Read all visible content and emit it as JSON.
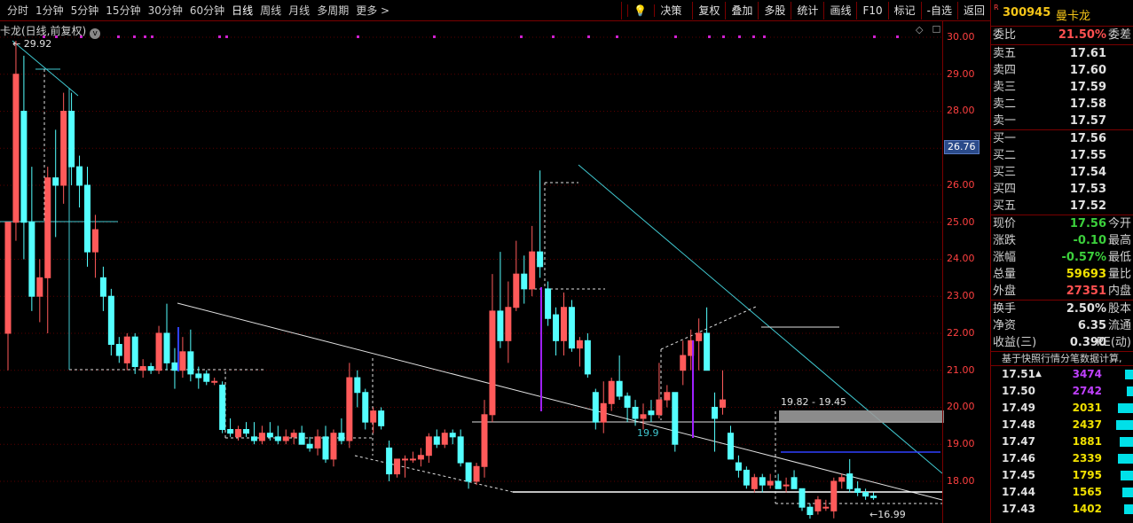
{
  "toolbar": {
    "periods": [
      "分时",
      "1分钟",
      "5分钟",
      "15分钟",
      "30分钟",
      "60分钟",
      "日线",
      "周线",
      "月线",
      "多周期",
      "更多 >"
    ],
    "active_period": "日线",
    "tools": [
      "决策",
      "复权",
      "叠加",
      "多股",
      "统计",
      "画线",
      "F10",
      "标记",
      "-自选",
      "返回"
    ]
  },
  "chart": {
    "title": "卡龙(日线,前复权)",
    "title_circle": "v",
    "high_label": "29.92",
    "low_label": "16.99",
    "range_label": "19.82 - 19.45",
    "support_label": "19.9",
    "crosshair_price": "26.76",
    "y_ticks": [
      "30.00",
      "29.00",
      "28.00",
      "27.00",
      "26.00",
      "25.00",
      "24.00",
      "23.00",
      "22.00",
      "21.00",
      "20.00",
      "19.00",
      "18.00"
    ],
    "controls": [
      "◇",
      "☐"
    ]
  },
  "chart_data": {
    "type": "candlestick",
    "ylim": [
      17.0,
      30.0
    ],
    "ohlc": [
      [
        22.0,
        25.0,
        21.0,
        25.0
      ],
      [
        25.0,
        29.9,
        24.5,
        29.0
      ],
      [
        28.0,
        29.5,
        24.0,
        25.0
      ],
      [
        25.0,
        26.5,
        22.6,
        23.0
      ],
      [
        23.0,
        24.0,
        22.3,
        23.5
      ],
      [
        23.5,
        26.5,
        22.0,
        26.2
      ],
      [
        26.2,
        27.5,
        24.6,
        26.0
      ],
      [
        26.0,
        28.5,
        25.5,
        28.0
      ],
      [
        28.0,
        28.5,
        26.0,
        26.5
      ],
      [
        26.5,
        26.8,
        25.4,
        26.0
      ],
      [
        26.0,
        26.5,
        23.8,
        24.2
      ],
      [
        24.2,
        25.2,
        23.5,
        24.8
      ],
      [
        23.5,
        23.8,
        22.6,
        23.0
      ],
      [
        23.0,
        23.2,
        21.4,
        21.7
      ],
      [
        21.7,
        21.9,
        21.2,
        21.4
      ],
      [
        21.2,
        22.0,
        21.0,
        21.9
      ],
      [
        21.9,
        22.0,
        20.9,
        21.1
      ],
      [
        21.0,
        21.3,
        20.8,
        21.1
      ],
      [
        21.1,
        21.2,
        20.9,
        21.0
      ],
      [
        21.0,
        22.2,
        20.9,
        22.0
      ],
      [
        22.0,
        22.8,
        21.0,
        21.2
      ],
      [
        21.2,
        21.6,
        20.5,
        21.0
      ],
      [
        21.0,
        21.9,
        20.8,
        21.5
      ],
      [
        21.5,
        22.1,
        20.7,
        20.9
      ],
      [
        20.9,
        21.1,
        20.5,
        20.8
      ],
      [
        20.9,
        21.0,
        20.6,
        20.7
      ],
      [
        20.7,
        20.8,
        20.6,
        20.7
      ],
      [
        20.6,
        20.7,
        19.3,
        19.4
      ],
      [
        19.4,
        19.7,
        19.2,
        19.3
      ],
      [
        19.2,
        19.5,
        19.1,
        19.4
      ],
      [
        19.4,
        19.6,
        19.2,
        19.3
      ],
      [
        19.2,
        19.6,
        19.0,
        19.1
      ],
      [
        19.1,
        19.5,
        19.0,
        19.3
      ],
      [
        19.3,
        19.6,
        19.1,
        19.2
      ],
      [
        19.2,
        19.5,
        19.0,
        19.1
      ],
      [
        19.1,
        19.4,
        19.0,
        19.2
      ],
      [
        19.2,
        19.4,
        19.0,
        19.3
      ],
      [
        19.3,
        19.5,
        19.0,
        19.0
      ],
      [
        19.0,
        19.2,
        18.8,
        18.9
      ],
      [
        18.9,
        19.4,
        18.7,
        19.2
      ],
      [
        19.2,
        19.5,
        18.5,
        18.6
      ],
      [
        18.6,
        19.4,
        18.4,
        19.3
      ],
      [
        19.3,
        19.7,
        19.0,
        19.1
      ],
      [
        19.1,
        21.2,
        18.9,
        20.8
      ],
      [
        20.8,
        21.0,
        20.0,
        20.4
      ],
      [
        20.4,
        20.5,
        19.4,
        19.6
      ],
      [
        19.6,
        20.0,
        19.3,
        19.9
      ],
      [
        19.9,
        20.0,
        19.4,
        19.5
      ],
      [
        18.9,
        19.1,
        18.0,
        18.2
      ],
      [
        18.2,
        18.6,
        18.1,
        18.6
      ],
      [
        18.6,
        18.7,
        18.1,
        18.6
      ],
      [
        18.6,
        18.8,
        18.5,
        18.6
      ],
      [
        18.6,
        18.9,
        18.4,
        18.7
      ],
      [
        18.7,
        19.3,
        18.5,
        19.2
      ],
      [
        19.2,
        19.4,
        18.9,
        19.0
      ],
      [
        19.0,
        19.4,
        18.9,
        19.3
      ],
      [
        19.3,
        19.4,
        19.0,
        19.2
      ],
      [
        19.2,
        19.4,
        18.4,
        18.5
      ],
      [
        18.5,
        18.5,
        17.8,
        18.0
      ],
      [
        18.0,
        18.5,
        17.9,
        18.4
      ],
      [
        18.4,
        20.2,
        18.1,
        19.8
      ],
      [
        19.8,
        23.6,
        19.6,
        22.6
      ],
      [
        22.6,
        24.2,
        21.6,
        21.8
      ],
      [
        21.8,
        23.4,
        21.2,
        22.7
      ],
      [
        22.7,
        24.5,
        22.6,
        23.6
      ],
      [
        23.6,
        24.1,
        22.8,
        23.2
      ],
      [
        23.2,
        24.9,
        23.0,
        24.2
      ],
      [
        24.2,
        26.4,
        23.5,
        23.8
      ],
      [
        23.2,
        23.4,
        22.2,
        22.4
      ],
      [
        22.5,
        22.7,
        21.4,
        21.8
      ],
      [
        21.8,
        23.1,
        21.4,
        22.7
      ],
      [
        22.7,
        22.9,
        21.5,
        21.6
      ],
      [
        21.6,
        21.9,
        21.1,
        21.8
      ],
      [
        21.8,
        22.0,
        20.8,
        20.9
      ],
      [
        20.4,
        20.5,
        19.4,
        19.6
      ],
      [
        19.6,
        20.7,
        19.3,
        20.1
      ],
      [
        20.1,
        20.8,
        19.9,
        20.7
      ],
      [
        20.7,
        21.4,
        20.2,
        20.3
      ],
      [
        20.3,
        20.4,
        19.6,
        20.0
      ],
      [
        20.0,
        20.2,
        19.5,
        19.7
      ],
      [
        19.7,
        20.1,
        19.4,
        19.8
      ],
      [
        19.9,
        20.2,
        19.6,
        19.8
      ],
      [
        19.8,
        21.2,
        19.7,
        20.2
      ],
      [
        20.2,
        20.6,
        20.0,
        20.4
      ],
      [
        20.4,
        20.4,
        18.8,
        19.0
      ],
      [
        21.0,
        21.8,
        20.6,
        21.4
      ],
      [
        21.4,
        22.1,
        21.0,
        21.8
      ],
      [
        21.8,
        22.4,
        21.0,
        22.0
      ],
      [
        22.0,
        22.7,
        21.0,
        21.0
      ],
      [
        20.0,
        20.4,
        18.8,
        19.7
      ],
      [
        20.0,
        21.0,
        19.8,
        20.2
      ],
      [
        19.3,
        19.5,
        18.6,
        18.6
      ],
      [
        18.5,
        18.7,
        18.1,
        18.3
      ],
      [
        18.3,
        18.4,
        17.8,
        17.9
      ],
      [
        17.8,
        18.2,
        17.7,
        18.1
      ],
      [
        18.1,
        18.2,
        17.7,
        17.9
      ],
      [
        17.9,
        18.2,
        17.8,
        18.0
      ],
      [
        18.0,
        18.2,
        17.8,
        17.8
      ],
      [
        17.9,
        18.1,
        17.7,
        17.9
      ],
      [
        18.1,
        18.3,
        17.8,
        17.8
      ],
      [
        17.8,
        17.8,
        17.2,
        17.3
      ],
      [
        17.3,
        17.4,
        16.99,
        17.1
      ],
      [
        17.2,
        17.6,
        17.1,
        17.5
      ],
      [
        17.3,
        17.5,
        17.2,
        17.3
      ],
      [
        17.2,
        18.1,
        17.0,
        18.0
      ],
      [
        18.0,
        18.2,
        17.8,
        18.1
      ],
      [
        18.2,
        18.6,
        17.7,
        17.8
      ],
      [
        17.8,
        18.0,
        17.6,
        17.7
      ],
      [
        17.7,
        17.8,
        17.5,
        17.6
      ],
      [
        17.6,
        17.7,
        17.5,
        17.56
      ]
    ]
  },
  "stock": {
    "code": "300945",
    "name": "曼卡龙",
    "r_mark": "R"
  },
  "quote": {
    "weibi": {
      "label": "委比",
      "value": "21.50%",
      "label2": "委差"
    },
    "sells": [
      {
        "label": "卖五",
        "price": "17.61"
      },
      {
        "label": "卖四",
        "price": "17.60"
      },
      {
        "label": "卖三",
        "price": "17.59"
      },
      {
        "label": "卖二",
        "price": "17.58"
      },
      {
        "label": "卖一",
        "price": "17.57"
      }
    ],
    "buys": [
      {
        "label": "买一",
        "price": "17.56"
      },
      {
        "label": "买二",
        "price": "17.55"
      },
      {
        "label": "买三",
        "price": "17.54"
      },
      {
        "label": "买四",
        "price": "17.53"
      },
      {
        "label": "买五",
        "price": "17.52"
      }
    ],
    "stats1": [
      {
        "label": "现价",
        "value": "17.56",
        "label2": "今开",
        "color": "green"
      },
      {
        "label": "涨跌",
        "value": "-0.10",
        "label2": "最高",
        "color": "green"
      },
      {
        "label": "涨幅",
        "value": "-0.57%",
        "label2": "最低",
        "color": "green"
      },
      {
        "label": "总量",
        "value": "59693",
        "label2": "量比",
        "color": "yellow"
      },
      {
        "label": "外盘",
        "value": "27351",
        "label2": "内盘",
        "color": "red"
      }
    ],
    "stats2": [
      {
        "label": "换手",
        "value": "2.50%",
        "label2": "股本",
        "color": "white"
      },
      {
        "label": "净资",
        "value": "6.35",
        "label2": "流通",
        "color": "white"
      },
      {
        "label": "收益(三)",
        "value": "0.390",
        "label2": "PE(动)",
        "color": "white"
      }
    ],
    "note": "基于快照行情分笔数据计算,",
    "ticks": [
      {
        "price": "17.51",
        "arrow": "▲",
        "vol": "3474",
        "color": "#c040ff",
        "bar": 0.26
      },
      {
        "price": "17.50",
        "arrow": "",
        "vol": "2742",
        "color": "#c040ff",
        "bar": 0.22
      },
      {
        "price": "17.49",
        "arrow": "",
        "vol": "2031",
        "color": "#f0e000",
        "bar": 0.5
      },
      {
        "price": "17.48",
        "arrow": "",
        "vol": "2437",
        "color": "#f0e000",
        "bar": 0.55
      },
      {
        "price": "17.47",
        "arrow": "",
        "vol": "1881",
        "color": "#f0e000",
        "bar": 0.45
      },
      {
        "price": "17.46",
        "arrow": "",
        "vol": "2339",
        "color": "#f0e000",
        "bar": 0.5
      },
      {
        "price": "17.45",
        "arrow": "",
        "vol": "1795",
        "color": "#f0e000",
        "bar": 0.4
      },
      {
        "price": "17.44",
        "arrow": "",
        "vol": "1565",
        "color": "#f0e000",
        "bar": 0.35
      },
      {
        "price": "17.43",
        "arrow": "",
        "vol": "1402",
        "color": "#f0e000",
        "bar": 0.3
      }
    ]
  }
}
